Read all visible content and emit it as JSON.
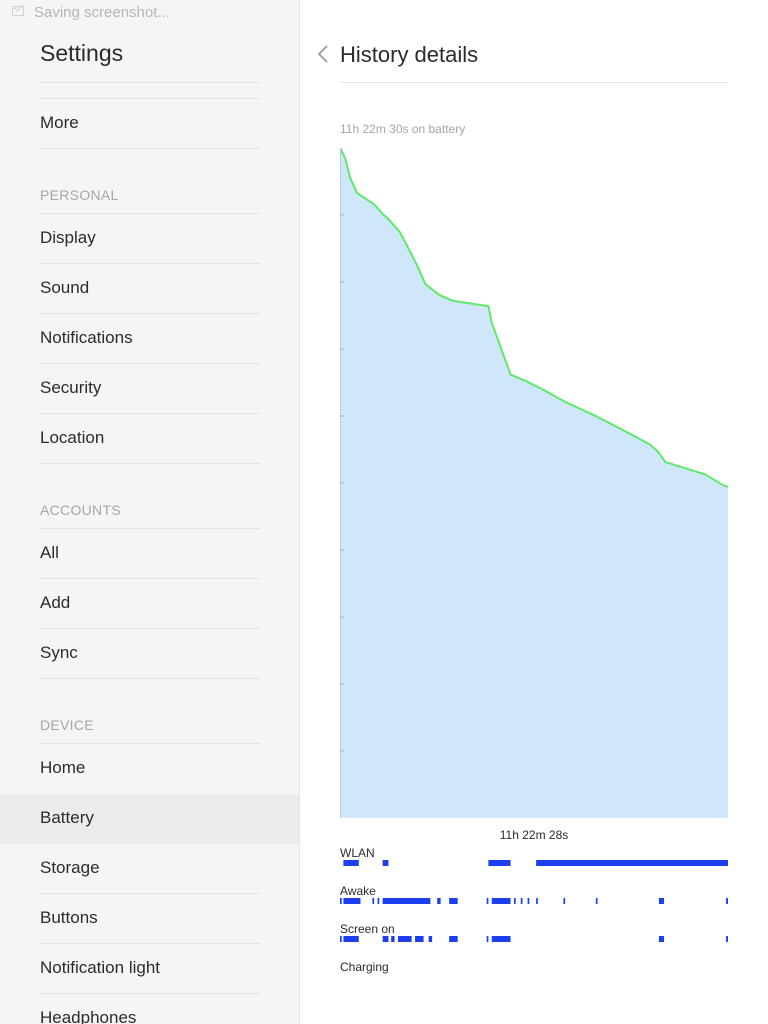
{
  "status_bar": {
    "notification_icon": "screenshot-icon",
    "text": "Saving screenshot..."
  },
  "sidebar": {
    "title": "Settings",
    "items_top": [
      {
        "label": "More"
      }
    ],
    "sections": [
      {
        "header": "PERSONAL",
        "items": [
          "Display",
          "Sound",
          "Notifications",
          "Security",
          "Location"
        ]
      },
      {
        "header": "ACCOUNTS",
        "items": [
          "All",
          "Add",
          "Sync"
        ]
      },
      {
        "header": "DEVICE",
        "items": [
          "Home",
          "Battery",
          "Storage",
          "Buttons",
          "Notification light",
          "Headphones"
        ]
      }
    ],
    "selected": "Battery"
  },
  "detail": {
    "back_icon": "chevron-left-icon",
    "title": "History details",
    "battery_summary": "11h 22m 30s on battery",
    "duration_label": "11h 22m 28s",
    "tracks": [
      {
        "label": "WLAN"
      },
      {
        "label": "Awake"
      },
      {
        "label": "Screen on"
      },
      {
        "label": "Charging"
      }
    ]
  },
  "colors": {
    "sidebar_bg": "#f4f5f4",
    "chart_fill": "#cfe6fb",
    "chart_line": "#5dea6a",
    "track_bar": "#1e3ff0",
    "active_item_bg": "#ebebeb"
  },
  "chart_data": {
    "type": "area",
    "title": "",
    "subtitle": "11h 22m 30s on battery",
    "xlabel": "11h 22m 28s",
    "ylabel": "",
    "xlim": [
      0,
      11.375
    ],
    "ylim": [
      0,
      100
    ],
    "grid": false,
    "series": [
      {
        "x": [
          0,
          0.15,
          0.3,
          0.5,
          1.0,
          1.28,
          1.4,
          1.75,
          2.05,
          2.25,
          2.5,
          2.9,
          3.3,
          4.35,
          4.45,
          5.0,
          5.5,
          6.0,
          6.6,
          7.5,
          8.3,
          9.1,
          9.3,
          9.55,
          10.7,
          11.22,
          11.375
        ],
        "y": [
          100,
          98.5,
          95.5,
          93.3,
          91.6,
          90.0,
          89.5,
          87.5,
          84.6,
          82.6,
          79.7,
          78.1,
          77.2,
          76.4,
          73.9,
          66.2,
          65.1,
          63.8,
          62.1,
          60.0,
          57.9,
          55.7,
          54.8,
          53.1,
          51.3,
          49.7,
          49.4
        ]
      }
    ],
    "tracks": [
      {
        "name": "WLAN",
        "intervals": [
          [
            0.1,
            0.55
          ],
          [
            1.25,
            1.42
          ],
          [
            4.35,
            5.0
          ],
          [
            5.75,
            11.375
          ]
        ]
      },
      {
        "name": "Awake",
        "intervals": [
          [
            0.0,
            0.05
          ],
          [
            0.1,
            0.6
          ],
          [
            0.95,
            1.0
          ],
          [
            1.1,
            1.15
          ],
          [
            1.25,
            2.65
          ],
          [
            2.85,
            2.95
          ],
          [
            3.2,
            3.45
          ],
          [
            4.3,
            4.35
          ],
          [
            4.45,
            5.0
          ],
          [
            5.1,
            5.15
          ],
          [
            5.3,
            5.35
          ],
          [
            5.5,
            5.55
          ],
          [
            5.75,
            5.8
          ],
          [
            6.55,
            6.6
          ],
          [
            7.5,
            7.55
          ],
          [
            9.35,
            9.5
          ],
          [
            11.32,
            11.375
          ]
        ]
      },
      {
        "name": "Screen on",
        "intervals": [
          [
            0.0,
            0.05
          ],
          [
            0.1,
            0.55
          ],
          [
            1.25,
            1.42
          ],
          [
            1.5,
            1.6
          ],
          [
            1.7,
            2.1
          ],
          [
            2.2,
            2.45
          ],
          [
            2.6,
            2.7
          ],
          [
            3.2,
            3.45
          ],
          [
            4.3,
            4.35
          ],
          [
            4.45,
            5.0
          ],
          [
            9.35,
            9.5
          ],
          [
            11.32,
            11.375
          ]
        ]
      },
      {
        "name": "Charging",
        "intervals": []
      }
    ]
  }
}
